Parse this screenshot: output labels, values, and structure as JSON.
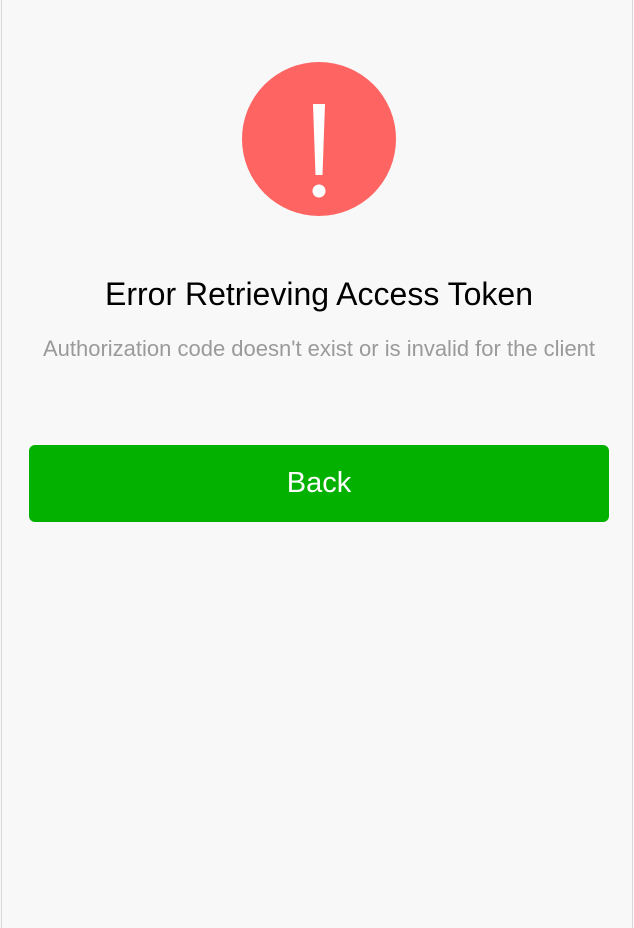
{
  "error": {
    "icon": "exclamation-circle-icon",
    "icon_color": "#fe6462",
    "title": "Error Retrieving Access Token",
    "description": "Authorization code doesn't exist or is invalid for the client"
  },
  "actions": {
    "back_label": "Back",
    "back_color": "#03b100"
  }
}
